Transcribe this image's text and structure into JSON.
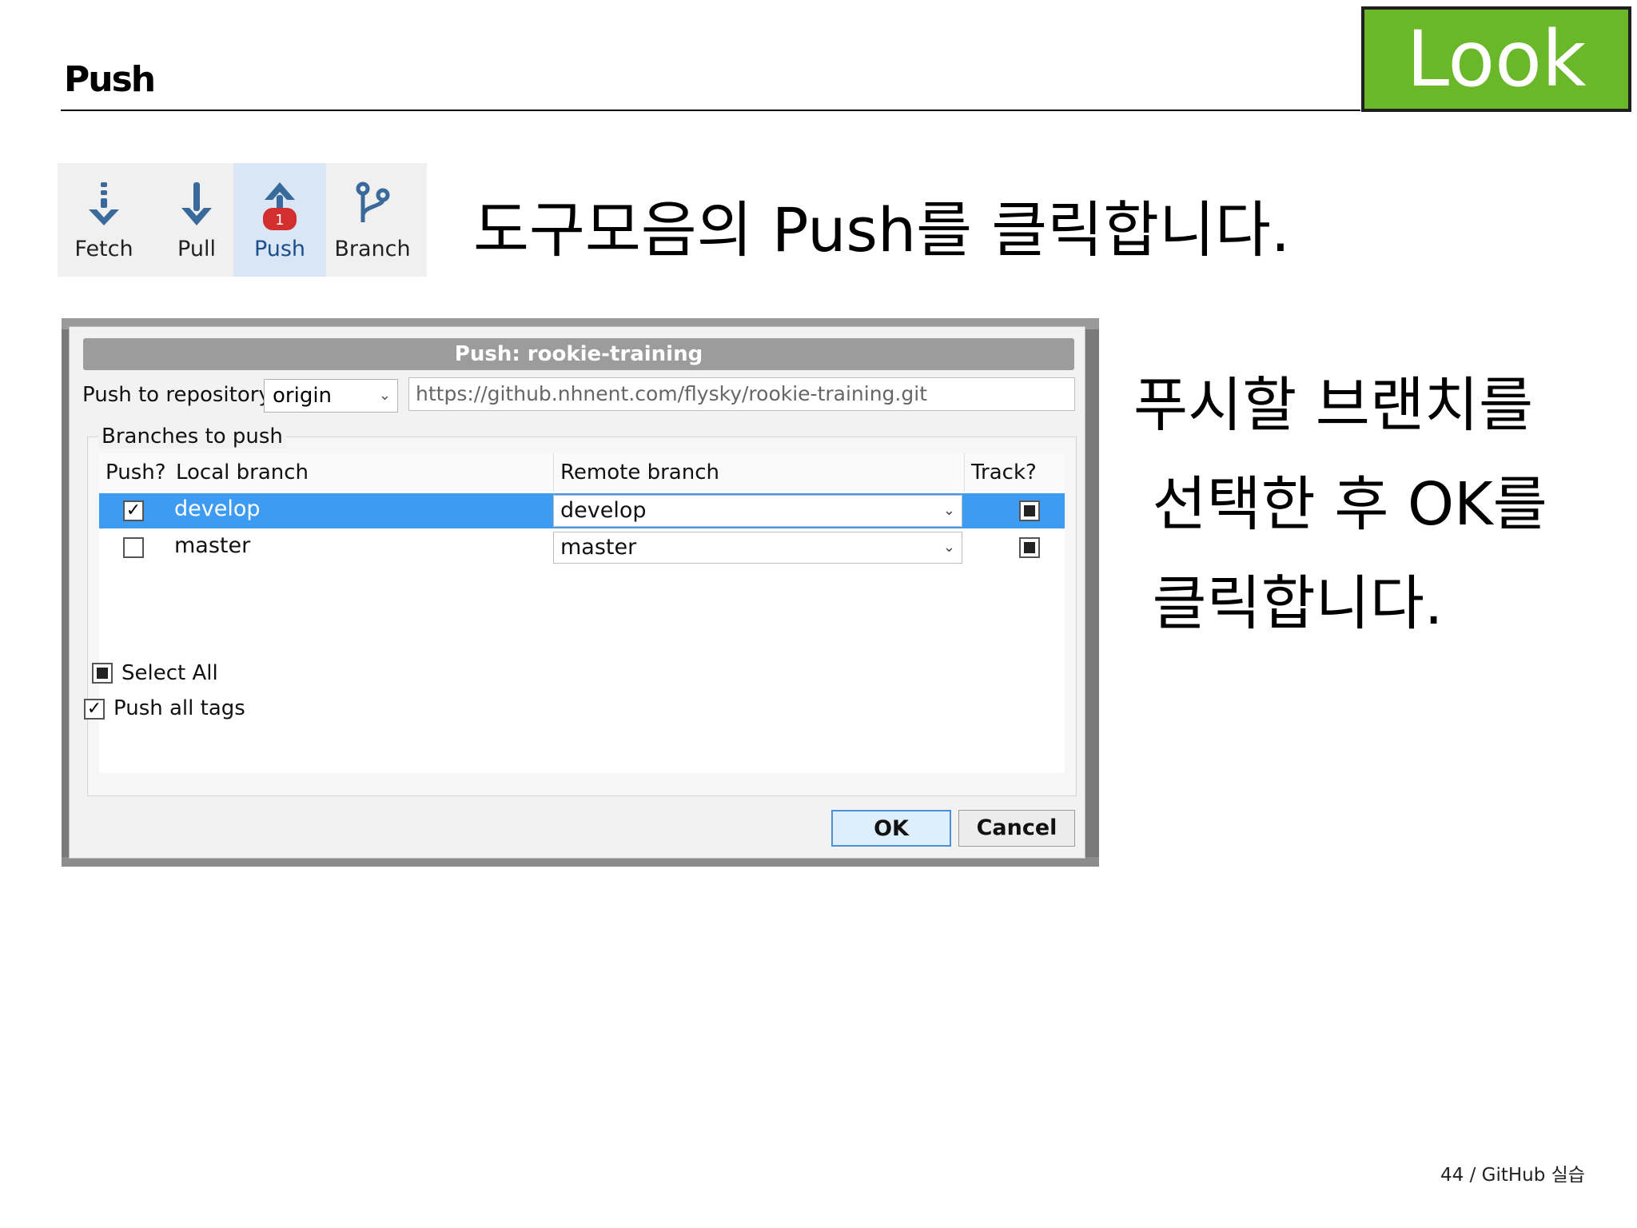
{
  "slide": {
    "title": "Push",
    "badge": "Look",
    "footer": "44 / GitHub 실습"
  },
  "toolbar": {
    "items": [
      {
        "label": "Fetch",
        "icon": "fetch-icon"
      },
      {
        "label": "Pull",
        "icon": "pull-icon"
      },
      {
        "label": "Push",
        "icon": "push-icon",
        "badge": "1",
        "active": true
      },
      {
        "label": "Branch",
        "icon": "branch-icon"
      }
    ]
  },
  "instructions": {
    "step1": "도구모음의 Push를 클릭합니다.",
    "step2": "푸시할 브랜치를\n 선택한 후 OK를\n 클릭합니다."
  },
  "dialog": {
    "title": "Push: rookie-training",
    "repo_label": "Push to repository:",
    "repo_value": "origin",
    "repo_url": "https://github.nhnent.com/flysky/rookie-training.git",
    "group_label": "Branches to push",
    "columns": {
      "push": "Push?",
      "local": "Local branch",
      "remote": "Remote branch",
      "track": "Track?"
    },
    "rows": [
      {
        "local": "develop",
        "remote": "develop",
        "push": true,
        "track": true,
        "selected": true
      },
      {
        "local": "master",
        "remote": "master",
        "push": false,
        "track": true,
        "selected": false
      }
    ],
    "select_all_label": "Select All",
    "push_tags_label": "Push all tags",
    "ok_label": "OK",
    "cancel_label": "Cancel"
  },
  "colors": {
    "badge": "#6ab82a",
    "selection": "#3d9bf2",
    "icon": "#3a6a9c",
    "push_badge": "#d32f2f"
  }
}
